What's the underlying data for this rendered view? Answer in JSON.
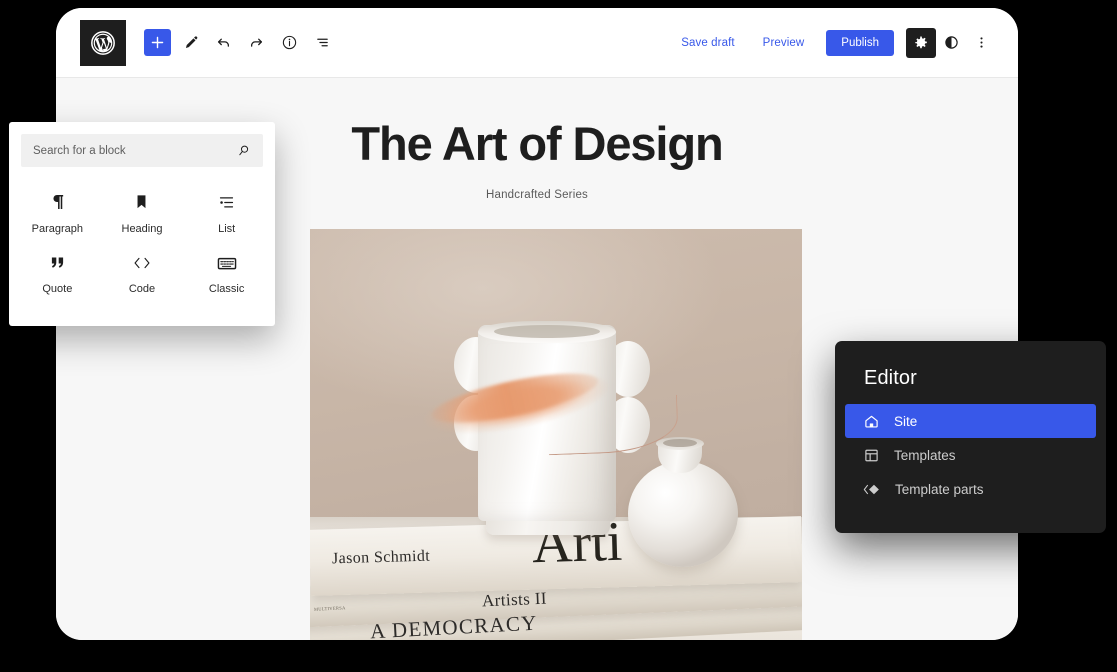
{
  "background_color": "#000000",
  "accent_color": "#3858e9",
  "dark_color": "#1e1e1e",
  "editor_window": {
    "toolbar": {
      "logo_icon": "wordpress-logo-icon",
      "left_buttons": [
        {
          "name": "add-block-button",
          "icon": "plus-icon",
          "label": "Add block"
        },
        {
          "name": "edit-tool-button",
          "icon": "pencil-icon",
          "label": "Tools"
        },
        {
          "name": "undo-button",
          "icon": "undo-arrow-icon",
          "label": "Undo"
        },
        {
          "name": "redo-button",
          "icon": "redo-arrow-icon",
          "label": "Redo"
        },
        {
          "name": "details-button",
          "icon": "info-circle-icon",
          "label": "Details"
        },
        {
          "name": "list-view-button",
          "icon": "list-view-icon",
          "label": "List view"
        }
      ],
      "save_draft_label": "Save draft",
      "preview_label": "Preview",
      "publish_label": "Publish",
      "settings_icon": "gear-icon",
      "styles_icon": "contrast-half-circle-icon",
      "options_icon": "three-dots-vertical-icon"
    },
    "canvas": {
      "title": "The Art of Design",
      "subtitle": "Handcrafted Series",
      "image": {
        "name": "still-life-photo",
        "alt": "Ceramic ribbed mug and small round vase with dried pampas grass resting on a stack of art books",
        "book_texts": {
          "author": "Jason Schmidt",
          "cover_large": "Arti",
          "title_two": "Artists II",
          "title_three": "A DEMOCRACY",
          "spine_small": "MULTIVERSA"
        }
      }
    }
  },
  "inserter_panel": {
    "search": {
      "placeholder": "Search for a block",
      "value": "",
      "icon": "search-icon"
    },
    "blocks": [
      {
        "label": "Paragraph",
        "icon": "paragraph-pilcrow-icon"
      },
      {
        "label": "Heading",
        "icon": "heading-bookmark-icon"
      },
      {
        "label": "List",
        "icon": "list-icon"
      },
      {
        "label": "Quote",
        "icon": "quote-marks-icon"
      },
      {
        "label": "Code",
        "icon": "code-angle-brackets-icon"
      },
      {
        "label": "Classic",
        "icon": "classic-keyboard-icon"
      }
    ]
  },
  "editor_panel": {
    "title": "Editor",
    "items": [
      {
        "label": "Site",
        "icon": "home-icon",
        "active": true
      },
      {
        "label": "Templates",
        "icon": "layout-grid-icon",
        "active": false
      },
      {
        "label": "Template parts",
        "icon": "diamond-layers-icon",
        "active": false
      }
    ]
  }
}
